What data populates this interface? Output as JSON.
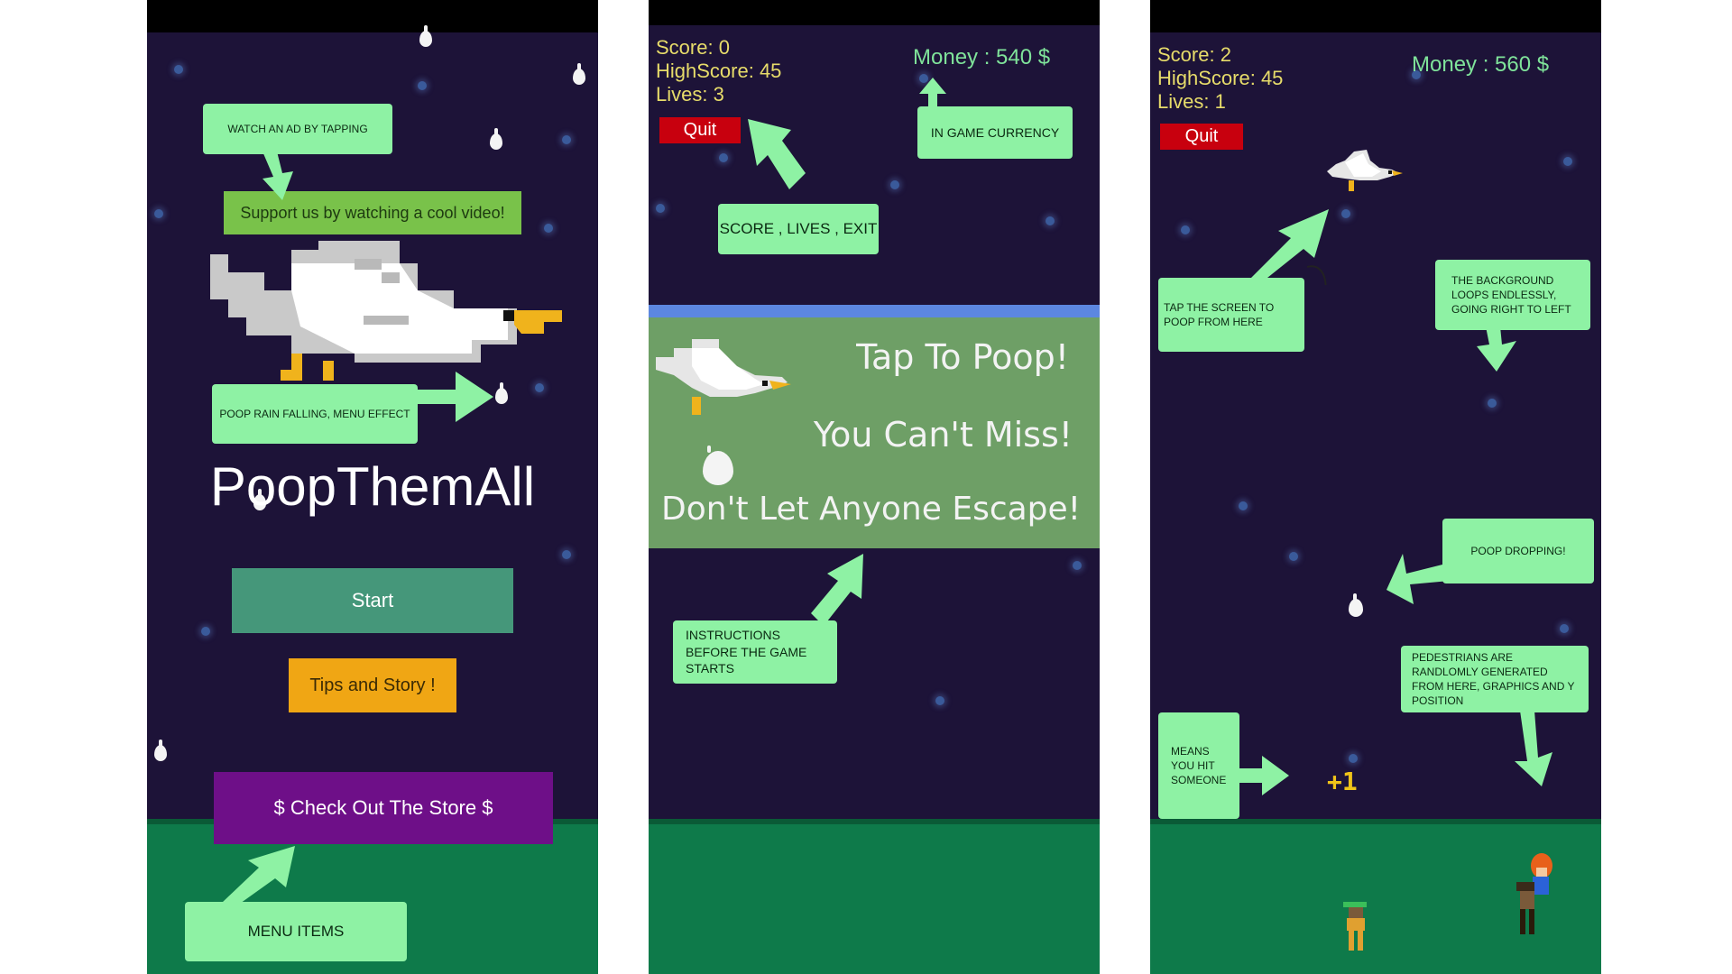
{
  "panel1": {
    "support_banner": "Support us by watching a cool video!",
    "title": "PoopThemAll",
    "start_label": "Start",
    "tips_label": "Tips and Story !",
    "store_label": "$ Check Out The Store $",
    "note_watch_ad": "WATCH AN AD BY TAPPING",
    "note_poop_rain": "POOP RAIN FALLING, MENU EFFECT",
    "note_menu_items": "MENU ITEMS"
  },
  "panel2": {
    "score": "Score: 0",
    "highscore": "HighScore: 45",
    "lives": "Lives: 3",
    "money": "Money : 540 $",
    "quit_label": "Quit",
    "note_currency": "IN GAME CURRENCY",
    "note_score": "SCORE , LIVES , EXIT",
    "instr_line1": "Tap To Poop!",
    "instr_line2": "You Can't Miss!",
    "instr_line3": "Don't Let Anyone Escape!",
    "note_instructions": "INSTRUCTIONS BEFORE THE GAME STARTS"
  },
  "panel3": {
    "score": "Score: 2",
    "highscore": "HighScore: 45",
    "lives": "Lives: 1",
    "money": "Money : 560 $",
    "quit_label": "Quit",
    "note_tap": "TAP THE SCREEN TO POOP FROM HERE",
    "note_background": "THE BACKGROUND LOOPS ENDLESSLY, GOING RIGHT TO LEFT",
    "note_poop_dropping": "POOP DROPPING!",
    "note_pedestrians": "PEDESTRIANS ARE RANDLOMLY GENERATED FROM HERE, GRAPHICS AND Y POSITION",
    "note_hit": "MEANS YOU HIT SOMEONE",
    "plus_one": "+1"
  },
  "colors": {
    "sky": "#1d1338",
    "ground": "#0e7a4a",
    "note": "#8ef2a4",
    "start_button": "#45977a",
    "tips_button": "#f0a614",
    "store_button": "#6e0f88",
    "quit_button": "#c8000e",
    "hud_text": "#e7dc6a",
    "money_text": "#7fe39a",
    "instructions_bg": "#6e9f66"
  },
  "icons": [
    "seagull-icon",
    "poop-drop-icon",
    "arrow-icon",
    "pedestrian-icon",
    "star-icon"
  ]
}
